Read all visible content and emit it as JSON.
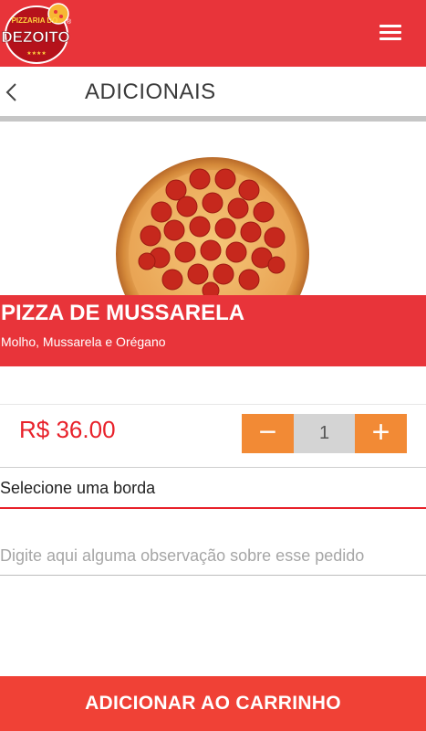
{
  "header": {
    "logo": {
      "top_text": "PIZZARIA DO",
      "main_text": "DEZOITO",
      "registered_mark": "®",
      "icon": "pizzeria-logo"
    },
    "menu_icon": "hamburger-menu-icon"
  },
  "titlebar": {
    "back_icon": "chevron-left-icon",
    "title": "ADICIONAIS"
  },
  "product": {
    "image": "pepperoni-pizza-image",
    "name": "PIZZA DE MUSSARELA",
    "description": "Molho, Mussarela e Orégano",
    "price": "R$ 36.00",
    "quantity": "1",
    "minus_label": "−",
    "plus_label": "+"
  },
  "form": {
    "border_select_label": "Selecione uma borda",
    "observation_placeholder": "Digite aqui alguma observação sobre esse pedido",
    "observation_value": ""
  },
  "footer": {
    "add_to_cart_label": "ADICIONAR AO CARRINHO"
  },
  "colors": {
    "brand_red": "#e8343a",
    "price_red": "#e8212a",
    "orange": "#f28a35",
    "cta_red": "#f04136"
  }
}
